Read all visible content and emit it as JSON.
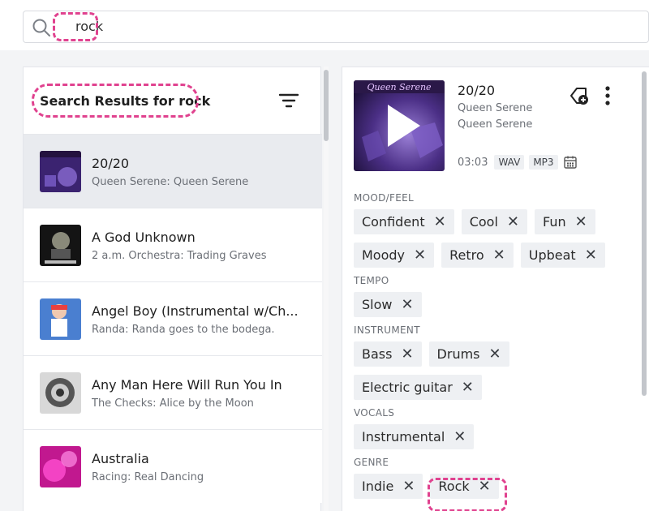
{
  "search": {
    "value": "rock"
  },
  "results": {
    "heading": "Search Results for rock",
    "items": [
      {
        "title": "20/20",
        "subtitle": "Queen Serene: Queen Serene",
        "selected": true
      },
      {
        "title": "A God Unknown",
        "subtitle": "2 a.m. Orchestra: Trading Graves",
        "selected": false
      },
      {
        "title": "Angel Boy (Instrumental w/Ch...",
        "subtitle": "Randa: Randa goes to the bodega.",
        "selected": false
      },
      {
        "title": "Any Man Here Will Run You In",
        "subtitle": "The Checks: Alice by the Moon",
        "selected": false
      },
      {
        "title": "Australia",
        "subtitle": "Racing: Real Dancing",
        "selected": false
      }
    ]
  },
  "detail": {
    "title": "20/20",
    "artist": "Queen Serene",
    "album": "Queen Serene",
    "duration": "03:03",
    "formats": [
      "WAV",
      "MP3"
    ],
    "sections": [
      {
        "label": "MOOD/FEEL",
        "rows": [
          [
            "Confident",
            "Cool",
            "Fun"
          ],
          [
            "Moody",
            "Retro",
            "Upbeat"
          ]
        ]
      },
      {
        "label": "TEMPO",
        "rows": [
          [
            "Slow"
          ]
        ]
      },
      {
        "label": "INSTRUMENT",
        "rows": [
          [
            "Bass",
            "Drums"
          ],
          [
            "Electric guitar"
          ]
        ]
      },
      {
        "label": "VOCALS",
        "rows": [
          [
            "Instrumental"
          ]
        ]
      },
      {
        "label": "GENRE",
        "rows": [
          [
            "Indie",
            "Rock"
          ]
        ]
      }
    ],
    "remove_glyph": "✕"
  },
  "colors": {
    "highlight": "#e0428f",
    "chip_bg": "#eef0f3",
    "selected_row": "#e9ebef"
  },
  "icons": [
    "search-icon",
    "filter-icon",
    "play-icon",
    "tag-add-icon",
    "more-vert-icon",
    "calendar-icon",
    "close-icon"
  ]
}
